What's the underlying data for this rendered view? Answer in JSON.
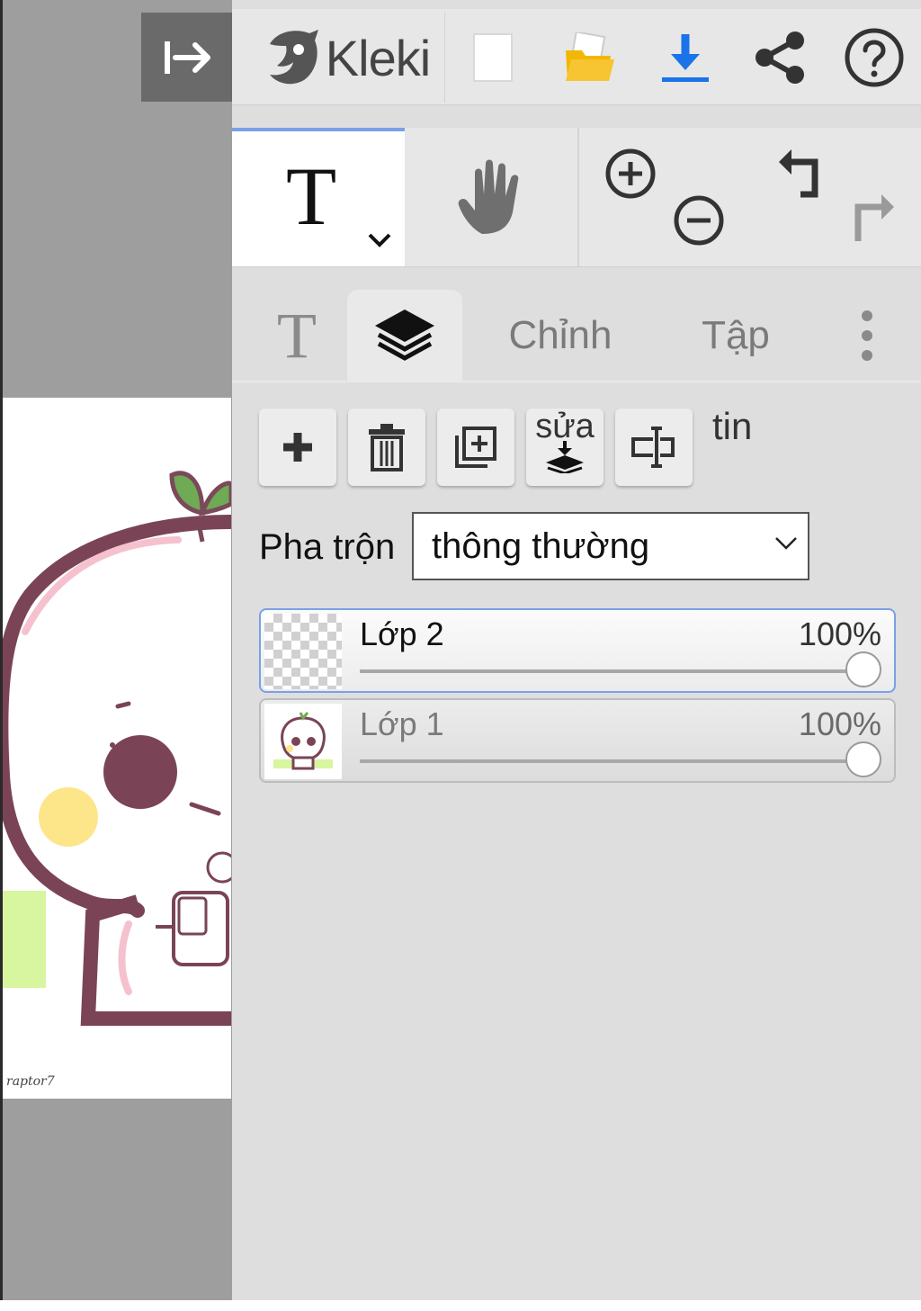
{
  "app": {
    "name": "Kleki"
  },
  "topbar": {
    "collapse_icon": "collapse-right-icon",
    "buttons": [
      "new-image-icon",
      "open-folder-icon",
      "download-icon",
      "share-icon",
      "help-icon"
    ]
  },
  "toolbar": {
    "active_tool": "text",
    "tools": [
      "text-tool-icon",
      "hand-tool-icon",
      "zoom-in-icon",
      "zoom-out-icon",
      "undo-icon",
      "redo-icon"
    ]
  },
  "tabs": {
    "text_glyph": "T",
    "edit": "Chỉnh",
    "file": "Tập",
    "active": "layers"
  },
  "layer_buttons": {
    "merge_label": "sửa",
    "info_label": "tin"
  },
  "blend": {
    "label": "Pha trộn",
    "value": "thông thường"
  },
  "layers": [
    {
      "name": "Lớp 2",
      "opacity_label": "100%",
      "opacity": 1.0,
      "selected": true
    },
    {
      "name": "Lớp 1",
      "opacity_label": "100%",
      "opacity": 1.0,
      "selected": false
    }
  ],
  "canvas": {
    "signature": "raptor7"
  },
  "colors": {
    "accent": "#7aa0e8",
    "download": "#1a73e8",
    "folder": "#f2b705",
    "panel_bg": "#dedede",
    "canvas_bg": "#9e9e9e"
  }
}
